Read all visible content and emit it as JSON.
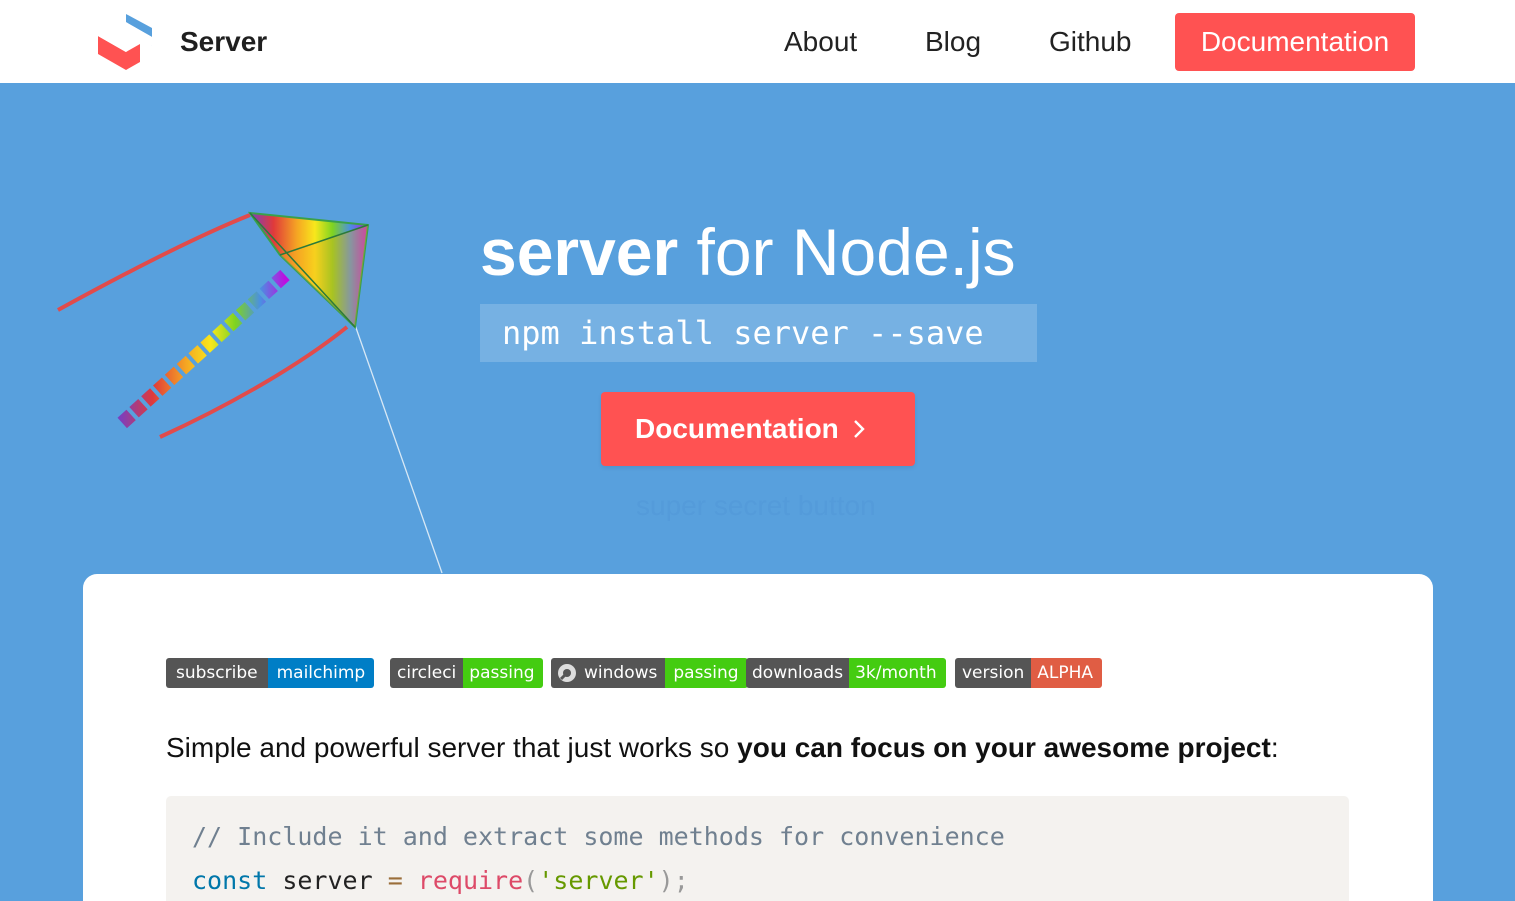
{
  "nav": {
    "brand": "Server",
    "links": [
      "About",
      "Blog",
      "Github"
    ],
    "cta": "Documentation"
  },
  "hero": {
    "title_bold": "server",
    "title_rest": " for Node.js",
    "install_command": "npm install server --save",
    "button_label": "Documentation",
    "secret_label": "super secret button"
  },
  "badges": [
    {
      "left": "subscribe",
      "right": "mailchimp",
      "color": "#007ec6"
    },
    {
      "left": "circleci",
      "right": "passing",
      "color": "#4c1"
    },
    {
      "left": "windows",
      "right": "passing",
      "color": "#4c1"
    },
    {
      "left": "downloads",
      "right": "3k/month",
      "color": "#4c1"
    },
    {
      "left": "version",
      "right": "ALPHA",
      "color": "#e05d44"
    }
  ],
  "intro": {
    "text": "Simple and powerful server that just works so ",
    "bold": "you can focus on your awesome project",
    "suffix": ":"
  },
  "code": {
    "comment": "// Include it and extract some methods for convenience",
    "kw": "const",
    "ident": " server ",
    "op": "=",
    "fn": " require",
    "open": "(",
    "str": "'server'",
    "close": ");"
  },
  "colors": {
    "accent": "#ff5252",
    "hero_bg": "#58a0dd"
  }
}
